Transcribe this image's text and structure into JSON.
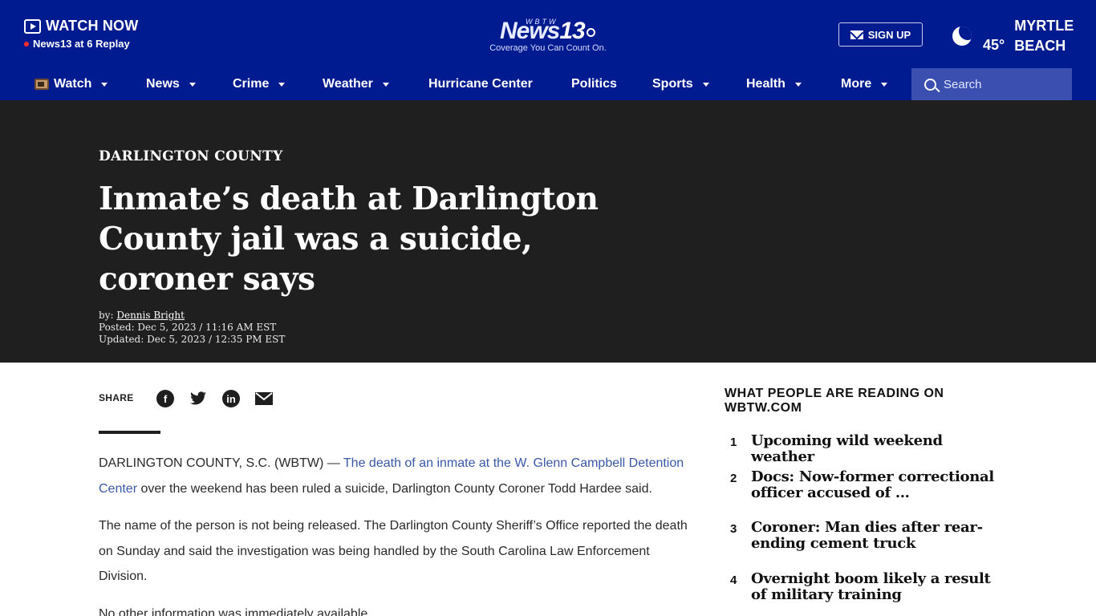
{
  "header": {
    "watch_now": "WATCH NOW",
    "replay": "News13 at 6 Replay",
    "logo_call": "WBTW",
    "logo_brand": "News",
    "logo_number": "13",
    "logo_tagline": "Coverage You Can Count On.",
    "signup": "SIGN UP",
    "weather": {
      "icon": "moon-icon",
      "temp": "45°",
      "city_line1": "MYRTLE",
      "city_line2": "BEACH"
    }
  },
  "nav": {
    "items": [
      {
        "label": "Watch",
        "dropdown": true,
        "icon": "tv-icon"
      },
      {
        "label": "News",
        "dropdown": true
      },
      {
        "label": "Crime",
        "dropdown": true
      },
      {
        "label": "Weather",
        "dropdown": true
      },
      {
        "label": "Hurricane Center",
        "dropdown": false
      },
      {
        "label": "Politics",
        "dropdown": false
      },
      {
        "label": "Sports",
        "dropdown": true
      },
      {
        "label": "Health",
        "dropdown": true
      },
      {
        "label": "More",
        "dropdown": true
      }
    ],
    "search_placeholder": "Search"
  },
  "article": {
    "section": "DARLINGTON COUNTY",
    "headline": "Inmate’s death at Darlington County jail was a suicide, coroner says",
    "by_prefix": "by:",
    "author": "Dennis Bright",
    "posted": "Posted: Dec 5, 2023 / 11:16 AM EST",
    "updated": "Updated: Dec 5, 2023 / 12:35 PM EST",
    "share_label": "SHARE",
    "share_icons": [
      "facebook-icon",
      "twitter-icon",
      "linkedin-icon",
      "email-icon"
    ],
    "p1_lead": "DARLINGTON COUNTY, S.C. (WBTW) — ",
    "p1_link": "The death of an inmate at the W. Glenn Campbell Detention Center",
    "p1_rest": " over the weekend has been ruled a suicide, Darlington County Coroner Todd Hardee said.",
    "p2": "The name of the person is not being released. The Darlington County Sheriff’s Office reported the death on Sunday and said the investigation was being handled by the South Carolina Law Enforcement Division.",
    "p3": "No other information was immediately available."
  },
  "sidebar": {
    "title": "WHAT PEOPLE ARE READING ON WBTW.COM",
    "items": [
      {
        "num": "1",
        "title": "Upcoming wild weekend weather"
      },
      {
        "num": "2",
        "title": "Docs: Now-former correctional officer accused of …"
      },
      {
        "num": "3",
        "title": "Coroner: Man dies after rear-ending cement truck"
      },
      {
        "num": "4",
        "title": "Overnight boom likely a result of military training"
      }
    ]
  },
  "colors": {
    "brand_blue": "#001a8f",
    "search_bg": "#3a4fb0",
    "hero_bg": "#1f1f1f",
    "link": "#3a58a8"
  }
}
